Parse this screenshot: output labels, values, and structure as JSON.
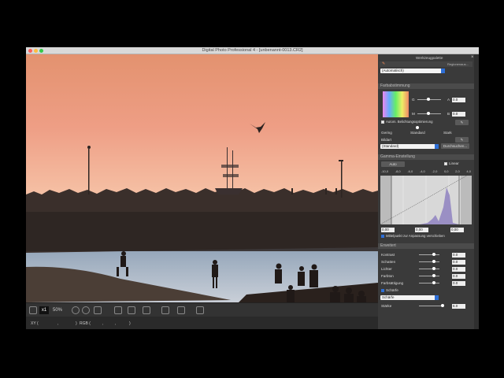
{
  "window": {
    "title": "Digital Photo Professional 4 - [unbenannt-0013.CR2]"
  },
  "toolbar": {
    "one_to_one": "x1",
    "zoom": "50%"
  },
  "statusbar": {
    "xy_label": "XY (",
    "xy_sep": ",",
    "xy_close": ")",
    "rgb_label": "RGB (",
    "rgb_sep1": ",",
    "rgb_sep2": ",",
    "rgb_close": ")"
  },
  "palette": {
    "title": "Werkzeugpalette",
    "mode_label": "Regionenaus...",
    "auto_select": "(Automatisch)",
    "sections": {
      "farb": "Farbabstimmung",
      "gamma": "Gamma-Einstellung",
      "erweitert": "Erweitert"
    },
    "farb": {
      "g": "G",
      "m": "M",
      "a": "A",
      "b": "B",
      "g_val": "0.0",
      "m_val": "0.0",
      "auto_label": "Autom. Belichtungsoptimierung",
      "gering": "Gering",
      "standard": "Standard",
      "stark": "Stark",
      "bildart": "Bildart",
      "bildart_value": "(Standard)",
      "durchsuchen": "Durchsuchen..."
    },
    "gamma": {
      "auto": "Auto",
      "linear": "Linear",
      "scale": [
        "-10,0",
        "-8,0",
        "-6,0",
        "-4,0",
        "-2,0",
        "0,0",
        "2,0",
        "4,0"
      ],
      "in1": "0,00",
      "in2": "0,00",
      "in3": "0,00",
      "mittel_label": "Mittelpunkt zur Anpassung verschieben"
    },
    "erweitert": {
      "kontrast": "Kontrast",
      "schatten": "Schatten",
      "lichter": "Lichter",
      "farbton": "Farbton",
      "farbsaettigung": "Farbsättigung",
      "v0": "0.0",
      "v1": "0.0",
      "v2": "0.0",
      "v3": "0.0",
      "v4": "0.0",
      "schaerfe": "Schärfe",
      "schaerfe_mode": "Schärfe",
      "staerke": "Stärke",
      "staerke_val": "6.0"
    }
  },
  "colors": {
    "accent": "#2e6fd6",
    "sky_top": "#e79a7c",
    "sky_bottom": "#f4c4a6",
    "sea": "#a7b5c7"
  }
}
